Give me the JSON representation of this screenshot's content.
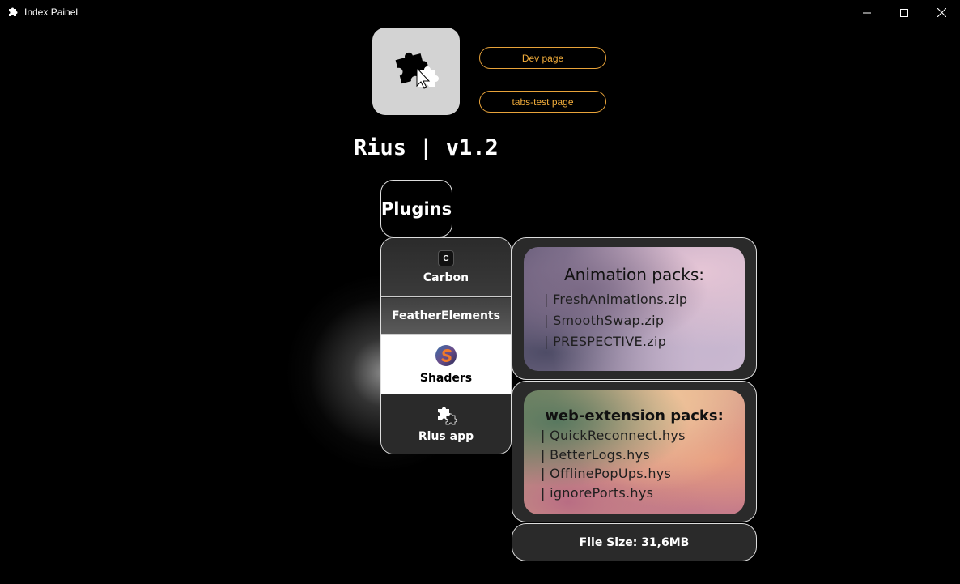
{
  "window": {
    "title": "Index Painel",
    "controls": {
      "minimize_icon": "minimize-icon",
      "maximize_icon": "maximize-icon",
      "close_icon": "close-icon"
    }
  },
  "header": {
    "logo_icon": "puzzle-icon",
    "dev_button": "Dev page",
    "tabs_button": "tabs-test page",
    "app_title": "Rius | v1.2",
    "accent_color": "#f2ad3b"
  },
  "plugins": {
    "tab_label": "Plugins",
    "items": [
      {
        "label": "Carbon",
        "icon": "carbon-c-icon",
        "icon_text": "C",
        "selected": false
      },
      {
        "label": "FeatherElements",
        "selected": false
      },
      {
        "label": "Shaders",
        "icon": "shaders-logo-icon",
        "selected": true
      },
      {
        "label": "Rius app",
        "icon": "puzzle-icon",
        "selected": false
      }
    ]
  },
  "cards": {
    "animation": {
      "title": "Animation packs:",
      "files": [
        "| FreshAnimations.zip",
        "| SmoothSwap.zip",
        "| PRESPECTIVE.zip"
      ]
    },
    "web_extension": {
      "title": "web-extension packs:",
      "files": [
        "| QuickReconnect.hys",
        "| BetterLogs.hys",
        "| OfflinePopUps.hys",
        "| ignorePorts.hys"
      ]
    }
  },
  "footer": {
    "file_size": "File Size: 31,6MB"
  }
}
